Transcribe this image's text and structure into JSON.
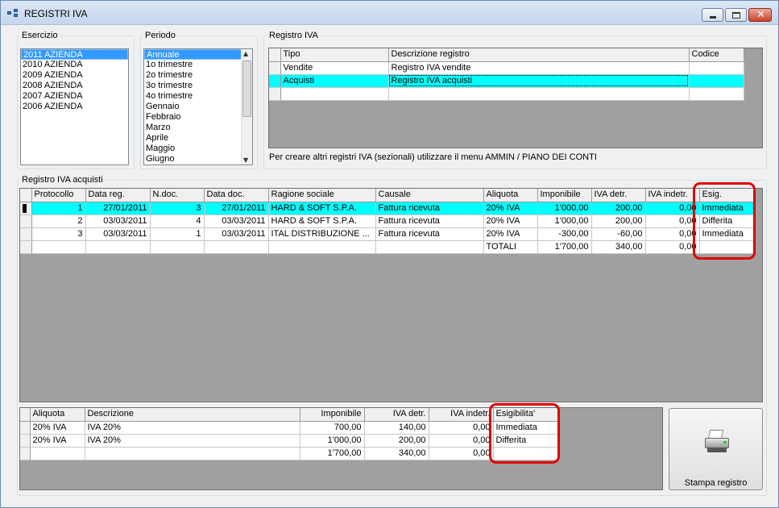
{
  "window": {
    "title": "REGISTRI IVA"
  },
  "esercizio": {
    "label": "Esercizio",
    "items": [
      "2011 AZIENDA",
      "2010 AZIENDA",
      "2009 AZIENDA",
      "2008 AZIENDA",
      "2007 AZIENDA",
      "2006 AZIENDA"
    ],
    "selected_index": 0
  },
  "periodo": {
    "label": "Periodo",
    "items": [
      "Annuale",
      "1o trimestre",
      "2o trimestre",
      "3o trimestre",
      "4o trimestre",
      "Gennaio",
      "Febbraio",
      "Marzo",
      "Aprile",
      "Maggio",
      "Giugno"
    ],
    "selected_index": 0
  },
  "registro_iva": {
    "label": "Registro IVA",
    "columns": [
      "Tipo",
      "Descrizione registro",
      "Codice"
    ],
    "rows": [
      {
        "tipo": "Vendite",
        "descrizione": "Registro IVA vendite",
        "codice": ""
      },
      {
        "tipo": "Acquisti",
        "descrizione": "Registro IVA acquisti",
        "codice": ""
      }
    ],
    "note": "Per creare altri registri IVA (sezionali) utilizzare il menu AMMIN / PIANO DEI CONTI"
  },
  "acquisti": {
    "label": "Registro IVA acquisti",
    "columns": [
      "Protocollo",
      "Data reg.",
      "N.doc.",
      "Data doc.",
      "Ragione sociale",
      "Causale",
      "Aliquota",
      "Imponibile",
      "IVA detr.",
      "IVA indetr.",
      "Esig."
    ],
    "rows": [
      {
        "protocollo": "1",
        "data_reg": "27/01/2011",
        "ndoc": "3",
        "data_doc": "27/01/2011",
        "ragione": "HARD & SOFT S.P.A.",
        "causale": "Fattura ricevuta",
        "aliquota": "20% IVA",
        "imponibile": "1'000,00",
        "iva_detr": "200,00",
        "iva_indetr": "0,00",
        "esig": "Immediata"
      },
      {
        "protocollo": "2",
        "data_reg": "03/03/2011",
        "ndoc": "4",
        "data_doc": "03/03/2011",
        "ragione": "HARD & SOFT S.P.A.",
        "causale": "Fattura ricevuta",
        "aliquota": "20% IVA",
        "imponibile": "1'000,00",
        "iva_detr": "200,00",
        "iva_indetr": "0,00",
        "esig": "Differita"
      },
      {
        "protocollo": "3",
        "data_reg": "03/03/2011",
        "ndoc": "1",
        "data_doc": "03/03/2011",
        "ragione": "ITAL DISTRIBUZIONE ...",
        "causale": "Fattura ricevuta",
        "aliquota": "20% IVA",
        "imponibile": "-300,00",
        "iva_detr": "-60,00",
        "iva_indetr": "0,00",
        "esig": "Immediata"
      }
    ],
    "totals": {
      "label": "TOTALI",
      "imponibile": "1'700,00",
      "iva_detr": "340,00",
      "iva_indetr": "0,00"
    }
  },
  "riepilogo": {
    "columns": [
      "Aliquota",
      "Descrizione",
      "Imponibile",
      "IVA detr.",
      "IVA indetr.",
      "Esigibilita'"
    ],
    "rows": [
      {
        "aliquota": "20% IVA",
        "descrizione": "IVA 20%",
        "imponibile": "700,00",
        "iva_detr": "140,00",
        "iva_indetr": "0,00",
        "esig": "Immediata"
      },
      {
        "aliquota": "20% IVA",
        "descrizione": "IVA 20%",
        "imponibile": "1'000,00",
        "iva_detr": "200,00",
        "iva_indetr": "0,00",
        "esig": "Differita"
      }
    ],
    "totals": {
      "imponibile": "1'700,00",
      "iva_detr": "340,00",
      "iva_indetr": "0,00"
    }
  },
  "print_button": {
    "label": "Stampa registro"
  },
  "colors": {
    "highlight_row": "#00ffff",
    "selection": "#3399ff",
    "annotation": "#e00000"
  }
}
